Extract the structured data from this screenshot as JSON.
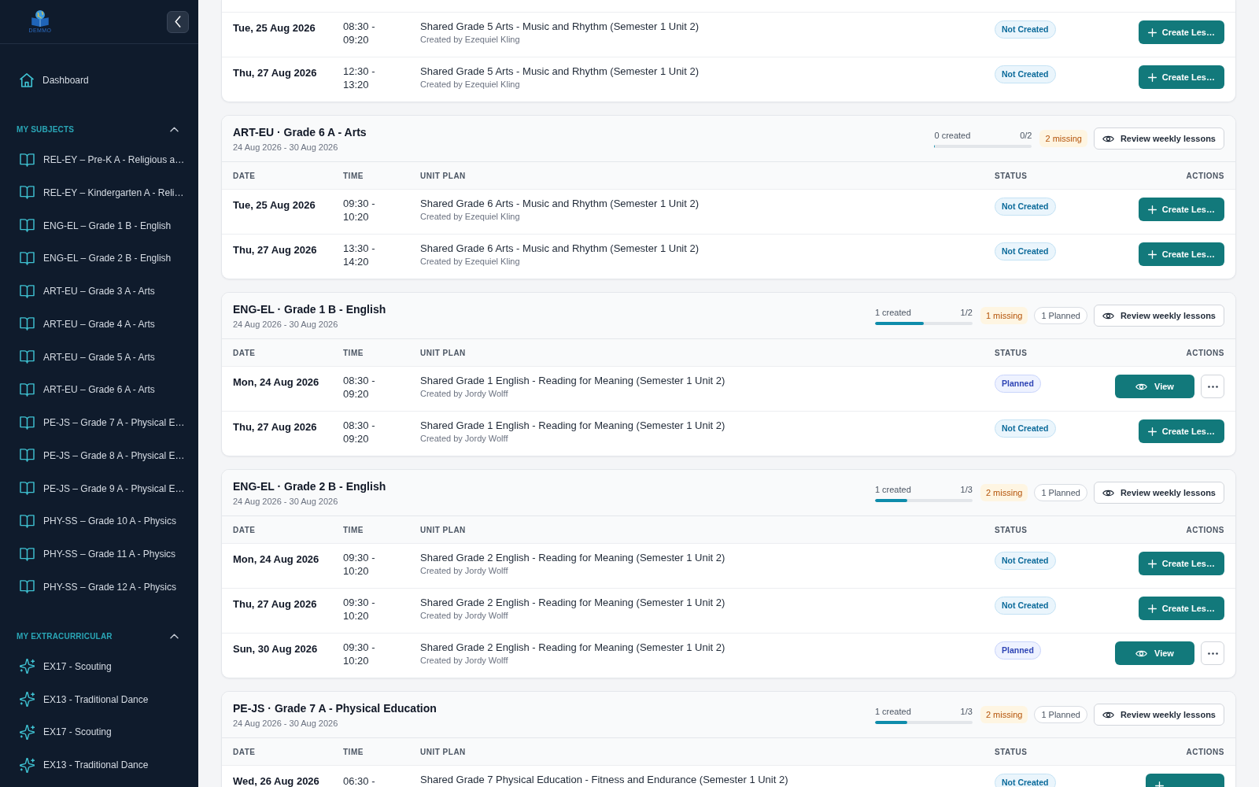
{
  "sidebar": {
    "logo": {
      "text": "DEMMO"
    },
    "nav": [
      {
        "label": "Dashboard",
        "selected": false
      }
    ],
    "sections": [
      {
        "title": "MY SUBJECTS",
        "expanded": true,
        "kind": "subjects",
        "items": [
          {
            "label": "REL-EY – Pre-K A - Religious a…",
            "selected": false
          },
          {
            "label": "REL-EY – Kindergarten A - Reli…",
            "selected": false
          },
          {
            "label": "ENG-EL – Grade 1 B - English",
            "selected": false
          },
          {
            "label": "ENG-EL – Grade 2 B - English",
            "selected": false
          },
          {
            "label": "ART-EU – Grade 3 A - Arts",
            "selected": false
          },
          {
            "label": "ART-EU – Grade 4 A - Arts",
            "selected": false
          },
          {
            "label": "ART-EU – Grade 5 A - Arts",
            "selected": false
          },
          {
            "label": "ART-EU – Grade 6 A - Arts",
            "selected": false
          },
          {
            "label": "PE-JS – Grade 7 A - Physical E…",
            "selected": false
          },
          {
            "label": "PE-JS – Grade 8 A - Physical E…",
            "selected": false
          },
          {
            "label": "PE-JS – Grade 9 A - Physical E…",
            "selected": false
          },
          {
            "label": "PHY-SS – Grade 10 A - Physics",
            "selected": false
          },
          {
            "label": "PHY-SS – Grade 11 A - Physics",
            "selected": false
          },
          {
            "label": "PHY-SS – Grade 12 A - Physics",
            "selected": false
          }
        ]
      },
      {
        "title": "MY EXTRACURRICULAR",
        "expanded": true,
        "kind": "extracurricular",
        "items": [
          {
            "label": "EX17 - Scouting",
            "selected": false
          },
          {
            "label": "EX13 - Traditional Dance",
            "selected": false
          },
          {
            "label": "EX17 - Scouting",
            "selected": false
          },
          {
            "label": "EX13 - Traditional Dance",
            "selected": false
          }
        ]
      }
    ]
  },
  "lesson_groups": [
    {
      "rows": [
        {
          "date": "Tue, 25 Aug 2026",
          "time": "08:30 - 09:20",
          "unit_plan": "Shared Grade 5 Arts - Music and Rhythm (Semester 1 Unit 2)",
          "created_by": "Created by Ezequiel Kling",
          "status": {
            "kind": "not_created",
            "label": "Not Created"
          },
          "actions": [
            {
              "kind": "create",
              "label": "Create Les…"
            }
          ]
        },
        {
          "date": "Thu, 27 Aug 2026",
          "time": "12:30 - 13:20",
          "unit_plan": "Shared Grade 5 Arts - Music and Rhythm (Semester 1 Unit 2)",
          "created_by": "Created by Ezequiel Kling",
          "status": {
            "kind": "not_created",
            "label": "Not Created"
          },
          "actions": [
            {
              "kind": "create",
              "label": "Create Les…"
            }
          ]
        }
      ]
    },
    {
      "title": "ART-EU · Grade 6 A - Arts",
      "date_range": "24 Aug 2026 - 30 Aug 2026",
      "progress": {
        "created": "0 created",
        "ratio": "0/2",
        "level": 0
      },
      "missing": "2 missing",
      "review_button": "Review weekly lessons",
      "columns": [
        "DATE",
        "TIME",
        "UNIT PLAN",
        "STATUS",
        "ACTIONS"
      ],
      "rows": [
        {
          "date": "Tue, 25 Aug 2026",
          "time": "09:30 - 10:20",
          "unit_plan": "Shared Grade 6 Arts - Music and Rhythm (Semester 1 Unit 2)",
          "created_by": "Created by Ezequiel Kling",
          "status": {
            "kind": "not_created",
            "label": "Not Created"
          },
          "actions": [
            {
              "kind": "create",
              "label": "Create Les…"
            }
          ]
        },
        {
          "date": "Thu, 27 Aug 2026",
          "time": "13:30 - 14:20",
          "unit_plan": "Shared Grade 6 Arts - Music and Rhythm (Semester 1 Unit 2)",
          "created_by": "Created by Ezequiel Kling",
          "status": {
            "kind": "not_created",
            "label": "Not Created"
          },
          "actions": [
            {
              "kind": "create",
              "label": "Create Les…"
            }
          ]
        }
      ]
    },
    {
      "title": "ENG-EL · Grade 1 B - English",
      "date_range": "24 Aug 2026 - 30 Aug 2026",
      "progress": {
        "created": "1 created",
        "ratio": "1/2",
        "level": 0.5
      },
      "missing": "1 missing",
      "planned": "1 Planned",
      "review_button": "Review weekly lessons",
      "columns": [
        "DATE",
        "TIME",
        "UNIT PLAN",
        "STATUS",
        "ACTIONS"
      ],
      "rows": [
        {
          "date": "Mon, 24 Aug 2026",
          "time": "08:30 - 09:20",
          "unit_plan": "Shared Grade 1 English - Reading for Meaning (Semester 1 Unit 2)",
          "created_by": "Created by Jordy Wolff",
          "status": {
            "kind": "planned",
            "label": "Planned"
          },
          "actions": [
            {
              "kind": "view",
              "label": "View"
            },
            {
              "kind": "more"
            }
          ]
        },
        {
          "date": "Thu, 27 Aug 2026",
          "time": "08:30 - 09:20",
          "unit_plan": "Shared Grade 1 English - Reading for Meaning (Semester 1 Unit 2)",
          "created_by": "Created by Jordy Wolff",
          "status": {
            "kind": "not_created",
            "label": "Not Created"
          },
          "actions": [
            {
              "kind": "create",
              "label": "Create Les…"
            }
          ]
        }
      ]
    },
    {
      "title": "ENG-EL · Grade 2 B - English",
      "date_range": "24 Aug 2026 - 30 Aug 2026",
      "progress": {
        "created": "1 created",
        "ratio": "1/3",
        "level": 0.33
      },
      "missing": "2 missing",
      "planned": "1 Planned",
      "review_button": "Review weekly lessons",
      "columns": [
        "DATE",
        "TIME",
        "UNIT PLAN",
        "STATUS",
        "ACTIONS"
      ],
      "rows": [
        {
          "date": "Mon, 24 Aug 2026",
          "time": "09:30 - 10:20",
          "unit_plan": "Shared Grade 2 English - Reading for Meaning (Semester 1 Unit 2)",
          "created_by": "Created by Jordy Wolff",
          "status": {
            "kind": "not_created",
            "label": "Not Created"
          },
          "actions": [
            {
              "kind": "create",
              "label": "Create Les…"
            }
          ]
        },
        {
          "date": "Thu, 27 Aug 2026",
          "time": "09:30 - 10:20",
          "unit_plan": "Shared Grade 2 English - Reading for Meaning (Semester 1 Unit 2)",
          "created_by": "Created by Jordy Wolff",
          "status": {
            "kind": "not_created",
            "label": "Not Created"
          },
          "actions": [
            {
              "kind": "create",
              "label": "Create Les…"
            }
          ]
        },
        {
          "date": "Sun, 30 Aug 2026",
          "time": "09:30 - 10:20",
          "unit_plan": "Shared Grade 2 English - Reading for Meaning (Semester 1 Unit 2)",
          "created_by": "Created by Jordy Wolff",
          "status": {
            "kind": "planned",
            "label": "Planned"
          },
          "actions": [
            {
              "kind": "view",
              "label": "View"
            },
            {
              "kind": "more"
            }
          ]
        }
      ]
    },
    {
      "title": "PE-JS · Grade 7 A - Physical Education",
      "date_range": "24 Aug 2026 - 30 Aug 2026",
      "progress": {
        "created": "1 created",
        "ratio": "1/3",
        "level": 0.33
      },
      "missing": "2 missing",
      "planned": "1 Planned",
      "review_button": "Review weekly lessons",
      "columns": [
        "DATE",
        "TIME",
        "UNIT PLAN",
        "STATUS",
        "ACTIONS"
      ],
      "rows": [
        {
          "date": "Wed, 26 Aug 2026",
          "time": "06:30 -",
          "unit_plan": "Shared Grade 7 Physical Education - Fitness and Endurance (Semester 1 Unit 2)",
          "status": {
            "kind": "not_created",
            "label": "Not Created"
          },
          "actions": [
            {
              "kind": "create"
            }
          ]
        }
      ]
    }
  ]
}
